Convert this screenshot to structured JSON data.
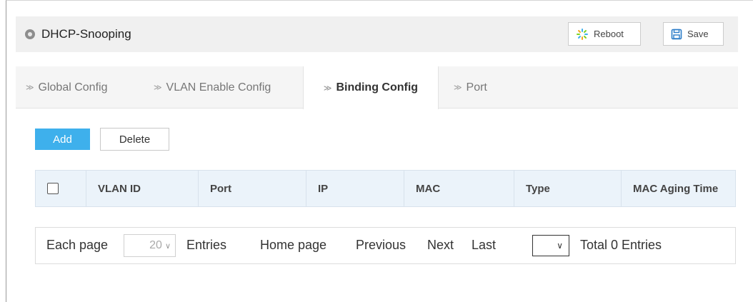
{
  "header": {
    "title": "DHCP-Snooping",
    "reboot_label": "Reboot",
    "save_label": "Save"
  },
  "tabs": [
    {
      "label": "Global Config"
    },
    {
      "label": "VLAN Enable Config"
    },
    {
      "label": "Binding Config",
      "active": true
    },
    {
      "label": "Port"
    }
  ],
  "actions": {
    "add_label": "Add",
    "delete_label": "Delete"
  },
  "table": {
    "columns": [
      "VLAN ID",
      "Port",
      "IP",
      "MAC",
      "Type",
      "MAC Aging Time"
    ],
    "rows": []
  },
  "pager": {
    "each_page_label": "Each page",
    "page_size": "20",
    "entries_label": "Entries",
    "home_label": "Home page",
    "previous_label": "Previous",
    "next_label": "Next",
    "last_label": "Last",
    "current_page": "",
    "total_label": "Total 0 Entries"
  },
  "colors": {
    "accent": "#3eb0ec",
    "header_bg": "#f0f0f0",
    "table_head_bg": "#ebf3fa"
  },
  "icons": {
    "header": "circle-dot-icon",
    "reboot": "spinner-icon",
    "save": "floppy-disk-icon",
    "tab": "chevron-double-right-icon"
  }
}
